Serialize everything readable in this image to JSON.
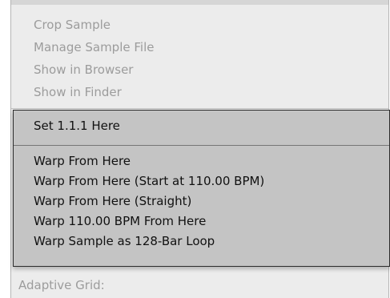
{
  "context_menu": {
    "file_items": [
      {
        "label": "Crop Sample",
        "enabled": false
      },
      {
        "label": "Manage Sample File",
        "enabled": false
      },
      {
        "label": "Show in Browser",
        "enabled": false
      },
      {
        "label": "Show in Finder",
        "enabled": false
      }
    ],
    "set_marker_label": "Set 1.1.1 Here",
    "warp_items": [
      {
        "label": "Warp From Here"
      },
      {
        "label": "Warp From Here (Start at 110.00 BPM)"
      },
      {
        "label": "Warp From Here (Straight)"
      },
      {
        "label": "Warp 110.00 BPM From Here"
      },
      {
        "label": "Warp Sample as 128-Bar Loop"
      }
    ],
    "adaptive_grid_label": "Adaptive Grid:"
  },
  "colors": {
    "menu_bg": "#ececec",
    "highlight_group_bg": "#c4c4c4",
    "disabled_text": "#9c9c9c",
    "text": "#111111"
  }
}
